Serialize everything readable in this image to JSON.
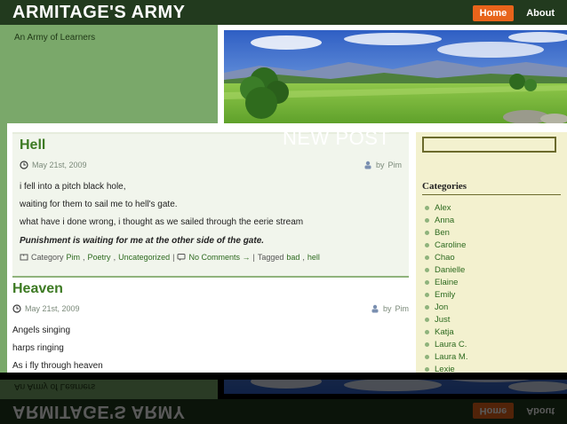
{
  "site": {
    "title": "ARMITAGE'S ARMY",
    "tagline": "An Army of Learners"
  },
  "nav": [
    {
      "label": "Home",
      "active": true
    },
    {
      "label": "About",
      "active": false
    }
  ],
  "overlay": {
    "new_post": "NEW POST"
  },
  "posts": [
    {
      "title": "Hell",
      "date": "May 21st, 2009",
      "author_prefix": "by",
      "author": "Pim",
      "lines": [
        "i fell into a pitch black hole,",
        "waiting for them to sail me to hell's gate.",
        "what have i done wrong, i thought as we sailed through the eerie stream"
      ],
      "emphasis": "Punishment is waiting for me at the other side of the gate.",
      "footer": {
        "category_label": "Category",
        "categories": [
          "Pim",
          "Poetry",
          "Uncategorized"
        ],
        "comments": "No Comments →",
        "tagged_label": "Tagged",
        "tags": [
          "bad",
          "hell"
        ]
      }
    },
    {
      "title": "Heaven",
      "date": "May 21st, 2009",
      "author_prefix": "by",
      "author": "Pim",
      "lines": [
        "Angels singing",
        "harps ringing",
        "As i fly through heaven"
      ]
    }
  ],
  "sidebar": {
    "search_placeholder": "",
    "categories_title": "Categories",
    "categories": [
      "Alex",
      "Anna",
      "Ben",
      "Caroline",
      "Chao",
      "Danielle",
      "Elaine",
      "Emily",
      "Jon",
      "Just",
      "Katja",
      "Laura C.",
      "Laura M.",
      "Lexie"
    ]
  },
  "colors": {
    "header": "#223a1e",
    "accent": "#e8641b",
    "green": "#7aa86a",
    "link": "#2d6a1f",
    "sidebar": "#f3f1cf"
  }
}
